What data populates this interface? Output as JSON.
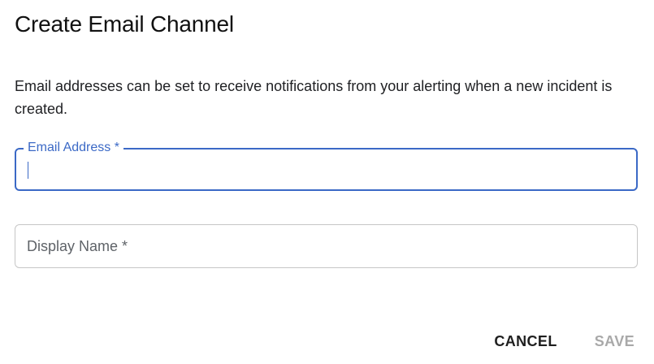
{
  "dialog": {
    "title": "Create Email Channel",
    "description": "Email addresses can be set to receive notifications from your alerting when a new incident is created."
  },
  "fields": {
    "email": {
      "label": "Email Address *",
      "value": "",
      "state": "focused"
    },
    "display_name": {
      "placeholder": "Display Name *",
      "value": ""
    }
  },
  "actions": {
    "cancel_label": "CANCEL",
    "save_label": "SAVE",
    "save_disabled": true
  },
  "colors": {
    "accent": "#3b69c6",
    "border": "#c6c6c6",
    "disabled_text": "#a9a9a9"
  }
}
